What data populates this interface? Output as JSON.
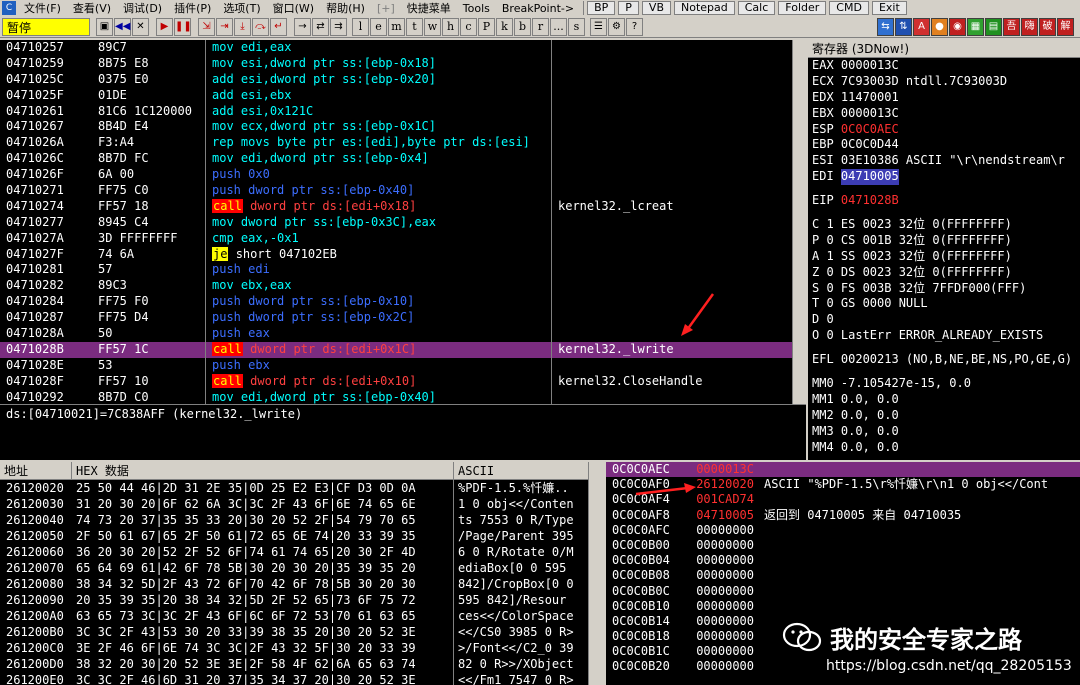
{
  "menubar": {
    "app_icon": "C",
    "items": [
      "文件(F)",
      "查看(V)",
      "调试(D)",
      "插件(P)",
      "选项(T)",
      "窗口(W)",
      "帮助(H)"
    ],
    "disabled_item": "[+]",
    "extra_items": [
      "快捷菜单",
      "Tools",
      "BreakPoint->"
    ],
    "tool_buttons": [
      "BP",
      "P",
      "VB",
      "Notepad",
      "Calc",
      "Folder",
      "CMD",
      "Exit"
    ]
  },
  "toolbar": {
    "status": "暂停",
    "letter_buttons": [
      "l",
      "e",
      "m",
      "t",
      "w",
      "h",
      "c",
      "P",
      "k",
      "b",
      "r",
      "...",
      "s"
    ]
  },
  "disasm": {
    "rows": [
      {
        "addr": "04710257",
        "hex": "89C7",
        "op": "mov",
        "args": "edi,eax",
        "cmt": ""
      },
      {
        "addr": "04710259",
        "hex": "8B75 E8",
        "op": "mov",
        "args": "esi,dword ptr ss:[ebp-0x18]",
        "cmt": ""
      },
      {
        "addr": "0471025C",
        "hex": "0375 E0",
        "op": "add",
        "args": "esi,dword ptr ss:[ebp-0x20]",
        "cmt": ""
      },
      {
        "addr": "0471025F",
        "hex": "01DE",
        "op": "add",
        "args": "esi,ebx",
        "cmt": ""
      },
      {
        "addr": "04710261",
        "hex": "81C6 1C120000",
        "op": "add",
        "args": "esi,0x121C",
        "cmt": ""
      },
      {
        "addr": "04710267",
        "hex": "8B4D E4",
        "op": "mov",
        "args": "ecx,dword ptr ss:[ebp-0x1C]",
        "cmt": ""
      },
      {
        "addr": "0471026A",
        "hex": "F3:A4",
        "op": "rep",
        "args": "movs byte ptr es:[edi],byte ptr ds:[esi]",
        "cmt": ""
      },
      {
        "addr": "0471026C",
        "hex": "8B7D FC",
        "op": "mov",
        "args": "edi,dword ptr ss:[ebp-0x4]",
        "cmt": ""
      },
      {
        "addr": "0471026F",
        "hex": "6A 00",
        "op": "push",
        "args": "0x0",
        "cmt": ""
      },
      {
        "addr": "04710271",
        "hex": "FF75 C0",
        "op": "push",
        "args": "dword ptr ss:[ebp-0x40]",
        "cmt": ""
      },
      {
        "addr": "04710274",
        "hex": "FF57 18",
        "op": "call",
        "args": "dword ptr ds:[edi+0x18]",
        "cmt": "kernel32._lcreat"
      },
      {
        "addr": "04710277",
        "hex": "8945 C4",
        "op": "mov",
        "args": "dword ptr ss:[ebp-0x3C],eax",
        "cmt": ""
      },
      {
        "addr": "0471027A",
        "hex": "3D FFFFFFFF",
        "op": "cmp",
        "args": "eax,-0x1",
        "cmt": ""
      },
      {
        "addr": "0471027F",
        "hex": "74 6A",
        "op": "je",
        "args": "short 047102EB",
        "cmt": ""
      },
      {
        "addr": "04710281",
        "hex": "57",
        "op": "push",
        "args": "edi",
        "cmt": ""
      },
      {
        "addr": "04710282",
        "hex": "89C3",
        "op": "mov",
        "args": "ebx,eax",
        "cmt": ""
      },
      {
        "addr": "04710284",
        "hex": "FF75 F0",
        "op": "push",
        "args": "dword ptr ss:[ebp-0x10]",
        "cmt": ""
      },
      {
        "addr": "04710287",
        "hex": "FF75 D4",
        "op": "push",
        "args": "dword ptr ss:[ebp-0x2C]",
        "cmt": ""
      },
      {
        "addr": "0471028A",
        "hex": "50",
        "op": "push",
        "args": "eax",
        "cmt": ""
      },
      {
        "addr": "0471028B",
        "hex": "FF57 1C",
        "op": "call",
        "args": "dword ptr ds:[edi+0x1C]",
        "cmt": "kernel32._lwrite",
        "selected": true
      },
      {
        "addr": "0471028E",
        "hex": "53",
        "op": "push",
        "args": "ebx",
        "cmt": ""
      },
      {
        "addr": "0471028F",
        "hex": "FF57 10",
        "op": "call",
        "args": "dword ptr ds:[edi+0x10]",
        "cmt": "kernel32.CloseHandle"
      },
      {
        "addr": "04710292",
        "hex": "8B7D C0",
        "op": "mov",
        "args": "edi,dword ptr ss:[ebp-0x40]",
        "cmt": ""
      }
    ]
  },
  "info_line": "ds:[04710021]=7C838AFF (kernel32._lwrite)",
  "registers": {
    "title": "寄存器 (3DNow!)",
    "rows": [
      {
        "text": "EAX 0000013C",
        "style": ""
      },
      {
        "text": "ECX 7C93003D ntdll.7C93003D",
        "style": ""
      },
      {
        "text": "EDX 11470001",
        "style": ""
      },
      {
        "text": "EBX 0000013C",
        "style": ""
      },
      {
        "text": "ESP 0C0C0AEC",
        "style": "red"
      },
      {
        "text": "EBP 0C0C0D44",
        "style": ""
      },
      {
        "text": "ESI 03E10386 ASCII \"\\r\\nendstream\\r",
        "style": ""
      },
      {
        "text": "EDI 04710005",
        "style": "hl"
      },
      {
        "text": "",
        "style": "gap"
      },
      {
        "text": "EIP 0471028B",
        "style": "red"
      },
      {
        "text": "",
        "style": "gap"
      },
      {
        "text": "C 1  ES 0023 32位 0(FFFFFFFF)",
        "style": ""
      },
      {
        "text": "P 0  CS 001B 32位 0(FFFFFFFF)",
        "style": ""
      },
      {
        "text": "A 1  SS 0023 32位 0(FFFFFFFF)",
        "style": ""
      },
      {
        "text": "Z 0  DS 0023 32位 0(FFFFFFFF)",
        "style": ""
      },
      {
        "text": "S 0  FS 003B 32位 7FFDF000(FFF)",
        "style": ""
      },
      {
        "text": "T 0  GS 0000 NULL",
        "style": ""
      },
      {
        "text": "D 0",
        "style": ""
      },
      {
        "text": "O 0  LastErr ERROR_ALREADY_EXISTS",
        "style": ""
      },
      {
        "text": "",
        "style": "gap"
      },
      {
        "text": "EFL 00200213 (NO,B,NE,BE,NS,PO,GE,G)",
        "style": ""
      },
      {
        "text": "",
        "style": "gap"
      },
      {
        "text": "MM0 -7.105427e-15,          0.0",
        "style": ""
      },
      {
        "text": "MM1           0.0,          0.0",
        "style": ""
      },
      {
        "text": "MM2           0.0,          0.0",
        "style": ""
      },
      {
        "text": "MM3           0.0,          0.0",
        "style": ""
      },
      {
        "text": "MM4           0.0,          0.0",
        "style": ""
      }
    ]
  },
  "dump": {
    "headers": [
      "地址",
      "HEX 数据",
      "ASCII"
    ],
    "rows": [
      {
        "a": "26120020",
        "h": "25 50 44 46|2D 31 2E 35|0D 25 E2 E3|CF D3 0D 0A",
        "s": "%PDF-1.5.%忏嬚.."
      },
      {
        "a": "26120030",
        "h": "31 20 30 20|6F 62 6A 3C|3C 2F 43 6F|6E 74 65 6E",
        "s": "1 0 obj<</Conten"
      },
      {
        "a": "26120040",
        "h": "74 73 20 37|35 35 33 20|30 20 52 2F|54 79 70 65",
        "s": "ts 7553 0 R/Type"
      },
      {
        "a": "26120050",
        "h": "2F 50 61 67|65 2F 50 61|72 65 6E 74|20 33 39 35",
        "s": "/Page/Parent 395"
      },
      {
        "a": "26120060",
        "h": "36 20 30 20|52 2F 52 6F|74 61 74 65|20 30 2F 4D",
        "s": "6 0 R/Rotate 0/M"
      },
      {
        "a": "26120070",
        "h": "65 64 69 61|42 6F 78 5B|30 20 30 20|35 39 35 20",
        "s": "ediaBox[0 0 595 "
      },
      {
        "a": "26120080",
        "h": "38 34 32 5D|2F 43 72 6F|70 42 6F 78|5B 30 20 30",
        "s": "842]/CropBox[0 0"
      },
      {
        "a": "26120090",
        "h": "20 35 39 35|20 38 34 32|5D 2F 52 65|73 6F 75 72",
        "s": " 595 842]/Resour"
      },
      {
        "a": "261200A0",
        "h": "63 65 73 3C|3C 2F 43 6F|6C 6F 72 53|70 61 63 65",
        "s": "ces<</ColorSpace"
      },
      {
        "a": "261200B0",
        "h": "3C 3C 2F 43|53 30 20 33|39 38 35 20|30 20 52 3E",
        "s": "<</CS0 3985 0 R>"
      },
      {
        "a": "261200C0",
        "h": "3E 2F 46 6F|6E 74 3C 3C|2F 43 32 5F|30 20 33 39",
        "s": ">/Font<</C2_0 39"
      },
      {
        "a": "261200D0",
        "h": "38 32 20 30|20 52 3E 3E|2F 58 4F 62|6A 65 63 74",
        "s": "82 0 R>>/XObject"
      },
      {
        "a": "261200E0",
        "h": "3C 3C 2F 46|6D 31 20 37|35 34 37 20|30 20 52 3E",
        "s": "<</Fm1 7547 0 R>"
      }
    ]
  },
  "stack": {
    "rows": [
      {
        "a": "0C0C0AEC",
        "v": "0000013C",
        "c": "",
        "top": true
      },
      {
        "a": "0C0C0AF0",
        "v": "26120020",
        "c": "ASCII \"%PDF-1.5\\r%忏嬚\\r\\n1 0 obj<</Cont",
        "red": true
      },
      {
        "a": "0C0C0AF4",
        "v": "001CAD74",
        "c": "",
        "red": true
      },
      {
        "a": "0C0C0AF8",
        "v": "04710005",
        "c": "返回到 04710005 来自 04710035",
        "red": true
      },
      {
        "a": "0C0C0AFC",
        "v": "00000000",
        "c": ""
      },
      {
        "a": "0C0C0B00",
        "v": "00000000",
        "c": ""
      },
      {
        "a": "0C0C0B04",
        "v": "00000000",
        "c": ""
      },
      {
        "a": "0C0C0B08",
        "v": "00000000",
        "c": ""
      },
      {
        "a": "0C0C0B0C",
        "v": "00000000",
        "c": ""
      },
      {
        "a": "0C0C0B10",
        "v": "00000000",
        "c": ""
      },
      {
        "a": "0C0C0B14",
        "v": "00000000",
        "c": ""
      },
      {
        "a": "0C0C0B18",
        "v": "00000000",
        "c": ""
      },
      {
        "a": "0C0C0B1C",
        "v": "00000000",
        "c": ""
      },
      {
        "a": "0C0C0B20",
        "v": "00000000",
        "c": ""
      }
    ]
  },
  "watermark": {
    "title": "我的安全专家之路",
    "url": "https://blog.csdn.net/qq_28205153"
  },
  "colors": {
    "selection": "#7b2c80",
    "call_bg": "#ff0000",
    "call_fg": "#ffff00",
    "push": "#3c6eff",
    "mov": "#00ffff",
    "annotation_arrow": "#ff2020"
  }
}
